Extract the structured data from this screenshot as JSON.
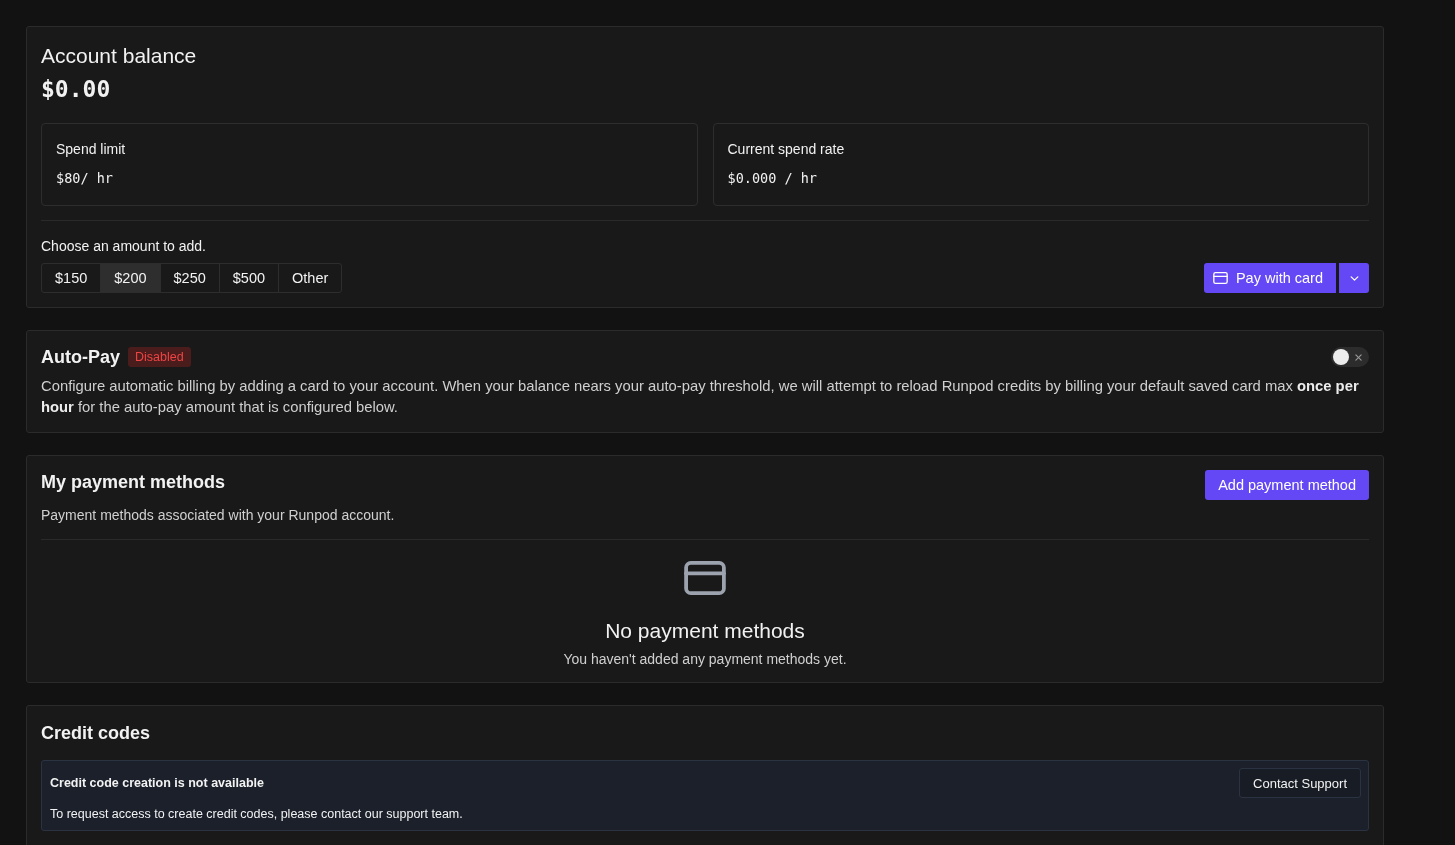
{
  "balance": {
    "title": "Account balance",
    "amount": "$0.00"
  },
  "stats": [
    {
      "label": "Spend limit",
      "value": "$80/ hr"
    },
    {
      "label": "Current spend rate",
      "value": "$0.000 / hr"
    }
  ],
  "amounts": {
    "prompt": "Choose an amount to add.",
    "options": [
      {
        "label": "$150",
        "selected": false
      },
      {
        "label": "$200",
        "selected": true
      },
      {
        "label": "$250",
        "selected": false
      },
      {
        "label": "$500",
        "selected": false
      },
      {
        "label": "Other",
        "selected": false
      }
    ]
  },
  "pay_button": {
    "label": "Pay with card"
  },
  "auto_pay": {
    "title": "Auto-Pay",
    "badge": "Disabled",
    "on": false,
    "description": "Configure automatic billing by adding a card to your account. When your balance nears your auto-pay threshold, we will attempt to reload Runpod credits by billing your default saved card max **once per hour** for the auto-pay amount that is configured below."
  },
  "payment_methods": {
    "title": "My payment methods",
    "subtitle": "Payment methods associated with your Runpod account.",
    "button": "Add payment method",
    "empty_title": "No payment methods",
    "empty_text": "You haven't added any payment methods yet."
  },
  "credit_codes": {
    "title": "Credit codes",
    "notice_title": "Credit code creation is not available",
    "notice_text": "To request access to create credit codes, please contact our support team.",
    "button": "Contact Support"
  }
}
